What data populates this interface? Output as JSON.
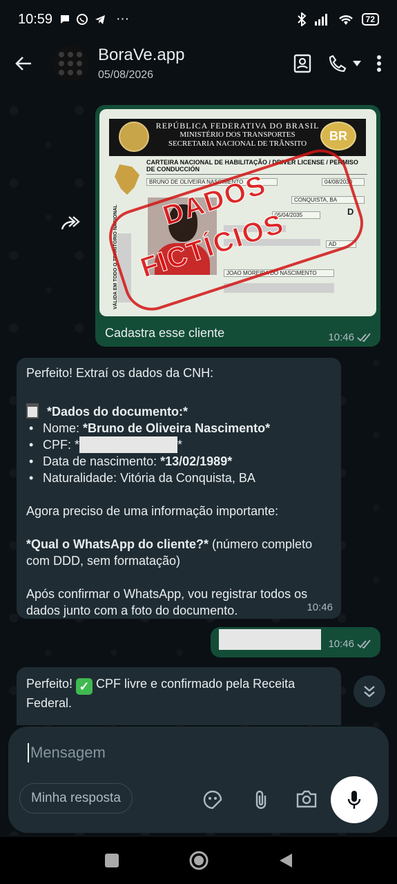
{
  "status_bar": {
    "time": "10:59",
    "more": "···",
    "battery": "72"
  },
  "header": {
    "title": "BoraVe.app",
    "subtitle": "05/08/2026"
  },
  "messages": {
    "image_message": {
      "caption": "Cadastra esse cliente",
      "time": "10:46",
      "document": {
        "republica": "REPÚBLICA FEDERATIVA DO BRASIL",
        "ministerio": "MINISTÉRIO DOS TRANSPORTES",
        "secretaria": "SECRETARIA NACIONAL DE TRÂNSITO",
        "br_badge": "BR",
        "heading": "CARTEIRA NACIONAL DE HABILITAÇÃO / DRIVER LICENSE / PERMISO DE CONDUCCIÓN",
        "name": "BRUNO DE OLIVEIRA NASCIMENTO",
        "date1": "04/08/2030",
        "city": "CONQUISTA, BA",
        "date2": "05/04/2035",
        "category": "D",
        "ad": "AD",
        "parent": "JOAO MOREIRA DO NASCIMENTO",
        "vertical_text": "VÁLIDA EM TODO O TERRITÓRIO NACIONAL",
        "stamp_line1": "DADOS",
        "stamp_line2": "FICTÍCIOS"
      }
    },
    "bot_message_1": {
      "intro": "Perfeito! Extraí os dados da CNH:",
      "section_title": "*Dados do documento:*",
      "name_label": "Nome: ",
      "name_value": "*Bruno de Oliveira Nascimento*",
      "cpf_label": "CPF: *",
      "cpf_suffix": "*",
      "birth_label": "Data de nascimento: ",
      "birth_value": "*13/02/1989*",
      "naturality": "Naturalidade: Vitória da Conquista, BA",
      "request": "Agora preciso de uma informação importante:",
      "question_bold": "*Qual o WhatsApp do cliente?*",
      "question_rest": " (número completo com DDD, sem formatação)",
      "after": "Após confirmar o WhatsApp, vou registrar todos os dados junto com a foto do documento.",
      "time": "10:46"
    },
    "user_message_2": {
      "time": "10:46"
    },
    "bot_message_2": {
      "prefix": "Perfeito! ",
      "text": " CPF livre e confirmado pela Receita Federal."
    }
  },
  "composer": {
    "placeholder": "Mensagem",
    "chip": "Minha resposta"
  },
  "colors": {
    "outgoing_bubble": "#134d37",
    "incoming_bubble": "#1f2c33",
    "background": "#0b1014",
    "read_ticks": "#aebac1"
  }
}
